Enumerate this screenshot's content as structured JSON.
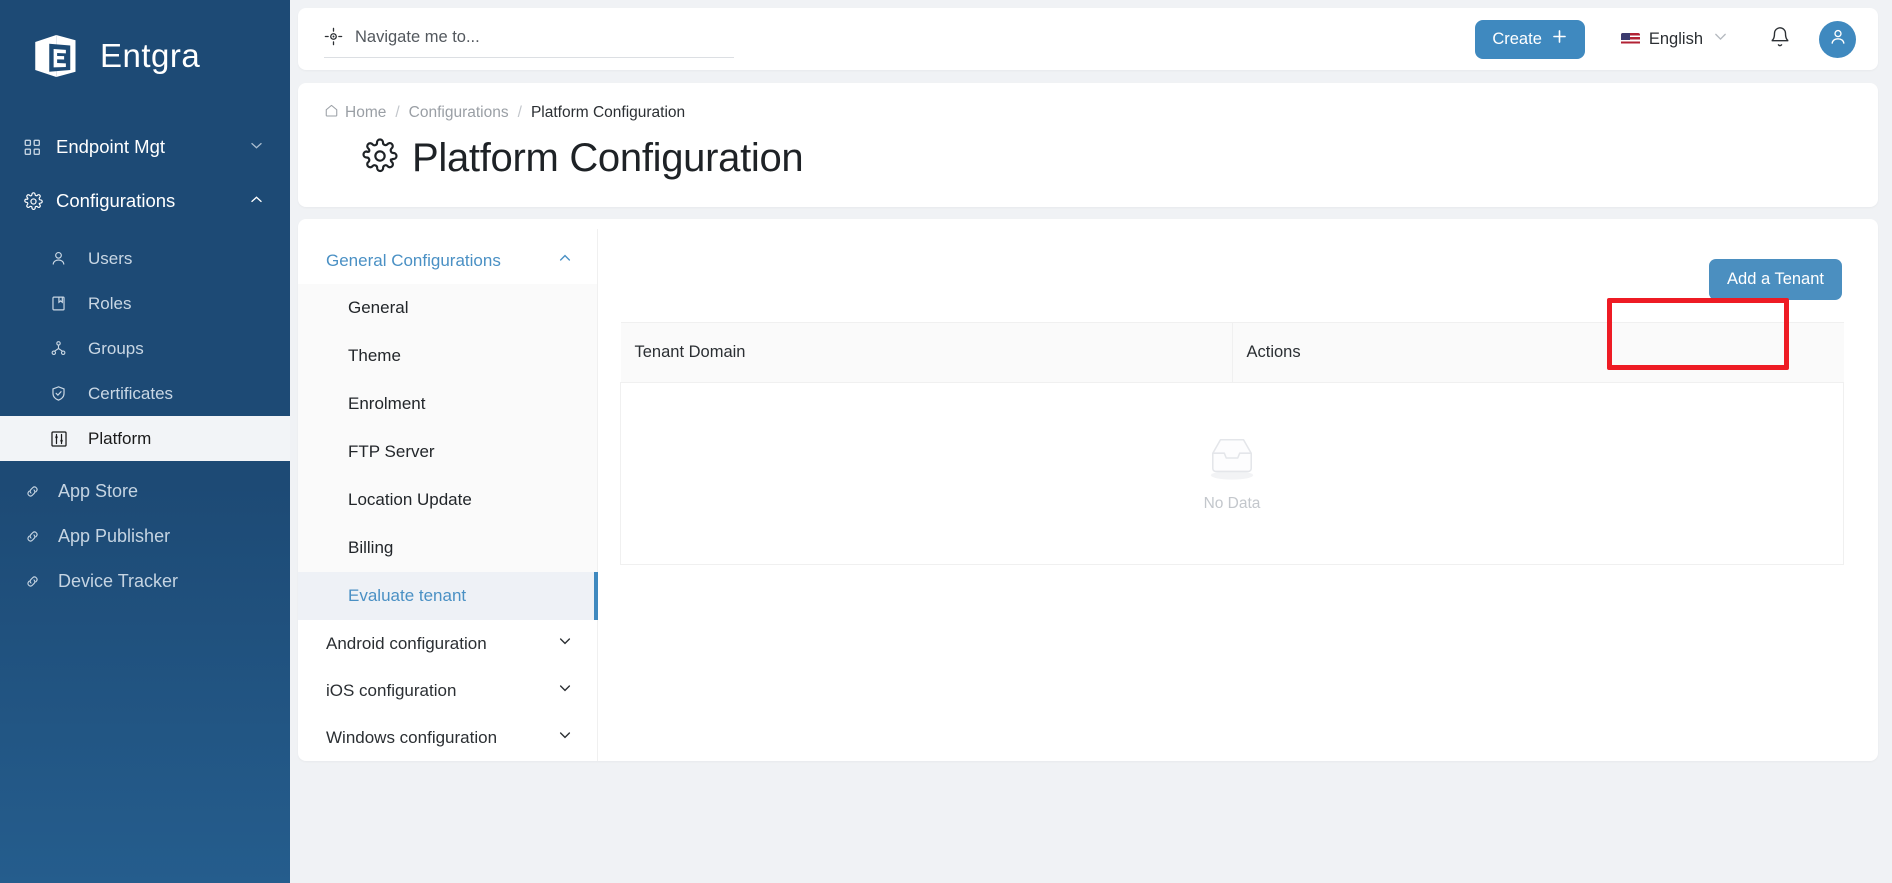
{
  "brand": {
    "name": "Entgra",
    "logo_icon": "entgra-cube-logo"
  },
  "sidebar": {
    "items": [
      {
        "label": "Endpoint Mgt",
        "icon": "grid-icon",
        "type": "group",
        "expanded": false,
        "chevron": "chevron-down-icon"
      },
      {
        "label": "Configurations",
        "icon": "gear-icon",
        "type": "group",
        "expanded": true,
        "chevron": "chevron-up-icon"
      },
      {
        "label": "Users",
        "icon": "user-icon",
        "type": "sub"
      },
      {
        "label": "Roles",
        "icon": "book-icon",
        "type": "sub"
      },
      {
        "label": "Groups",
        "icon": "groups-icon",
        "type": "sub"
      },
      {
        "label": "Certificates",
        "icon": "shield-check-icon",
        "type": "sub"
      },
      {
        "label": "Platform",
        "icon": "sliders-icon",
        "type": "sub",
        "active": true
      },
      {
        "label": "App Store",
        "icon": "link-icon",
        "type": "external"
      },
      {
        "label": "App Publisher",
        "icon": "link-icon",
        "type": "external"
      },
      {
        "label": "Device Tracker",
        "icon": "link-icon",
        "type": "external"
      }
    ]
  },
  "topbar": {
    "search": {
      "icon": "navigate-crosshair-icon",
      "placeholder": "Navigate me to...",
      "value": ""
    },
    "create_label": "Create",
    "create_icon": "plus-icon",
    "language": {
      "label": "English",
      "flag": "us-flag-icon",
      "chevron": "chevron-down-icon"
    },
    "notifications_icon": "bell-icon",
    "avatar_icon": "user-avatar-icon"
  },
  "breadcrumb": {
    "home": "Home",
    "home_icon": "home-icon",
    "separator": "/",
    "level2": "Configurations",
    "level3": "Platform Configuration"
  },
  "page": {
    "title": "Platform Configuration",
    "title_icon": "gear-icon"
  },
  "config_menu": {
    "groups": [
      {
        "label": "General Configurations",
        "expanded": true,
        "chevron": "chevron-up-icon",
        "items": [
          {
            "label": "General",
            "selected": false
          },
          {
            "label": "Theme",
            "selected": false
          },
          {
            "label": "Enrolment",
            "selected": false
          },
          {
            "label": "FTP Server",
            "selected": false
          },
          {
            "label": "Location Update",
            "selected": false
          },
          {
            "label": "Billing",
            "selected": false
          },
          {
            "label": "Evaluate tenant",
            "selected": true
          }
        ]
      },
      {
        "label": "Android configuration",
        "expanded": false,
        "chevron": "chevron-down-icon",
        "items": []
      },
      {
        "label": "iOS configuration",
        "expanded": false,
        "chevron": "chevron-down-icon",
        "items": []
      },
      {
        "label": "Windows configuration",
        "expanded": false,
        "chevron": "chevron-down-icon",
        "items": []
      }
    ]
  },
  "panel": {
    "add_tenant_label": "Add a Tenant",
    "table": {
      "columns": [
        "Tenant Domain",
        "Actions"
      ],
      "rows": [],
      "empty_text": "No Data",
      "empty_icon": "empty-inbox-icon"
    },
    "highlight": {
      "shape": "rectangle",
      "color": "#ee1b24",
      "target": "add-tenant-button"
    }
  },
  "colors": {
    "sidebar_top": "#1d4a75",
    "sidebar_bottom": "#255d8d",
    "accent_blue": "#3f89bf",
    "link_blue": "#4a90c4",
    "page_bg": "#f0f2f5",
    "highlight_red": "#ee1b24"
  }
}
